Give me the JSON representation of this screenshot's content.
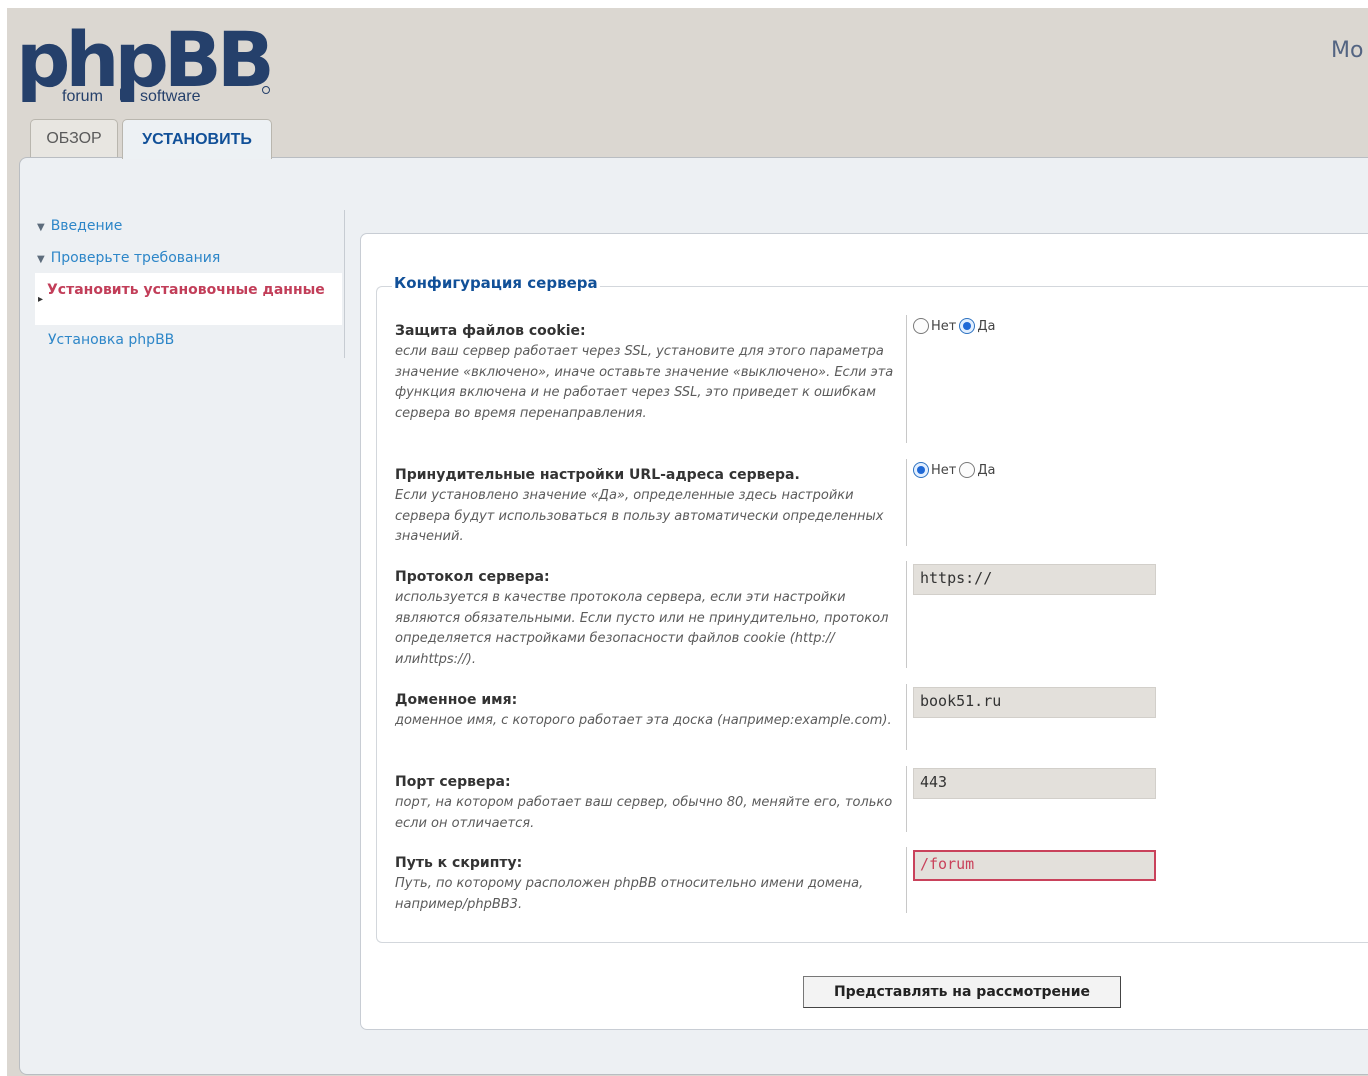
{
  "logo": {
    "name": "phpBB",
    "tagline_left": "forum",
    "tagline_right": "software"
  },
  "header": {
    "right_text": "Mo"
  },
  "tabs": [
    {
      "label": "ОБЗОР"
    },
    {
      "label": "УСТАНОВИТЬ"
    }
  ],
  "sidebar": {
    "items": [
      {
        "label": "Введение"
      },
      {
        "label": "Проверьте требования"
      },
      {
        "label": "Установить установочные данные"
      },
      {
        "label": "Установка phpBB"
      }
    ]
  },
  "form": {
    "legend": "Конфигурация сервера",
    "options": [
      {
        "label": "Защита файлов cookie:",
        "description": "если ваш сервер работает через SSL, установите для этого параметра значение «включено», иначе оставьте значение «выключено». Если эта функция включена и не работает через SSL, это приведет к ошибкам сервера во время перенаправления.",
        "choices": [
          "Нет",
          "Да"
        ],
        "selected": "Да"
      },
      {
        "label": "Принудительные настройки URL-адреса сервера.",
        "description": "Если установлено значение «Да», определенные здесь настройки сервера будут использоваться в пользу автоматически определенных значений.",
        "choices": [
          "Нет",
          "Да"
        ],
        "selected": "Нет"
      },
      {
        "label": "Протокол сервера:",
        "description": "используется в качестве протокола сервера, если эти настройки являются обязательными. Если пусто или не принудительно, протокол определяется настройками безопасности файлов cookie (http://илиhttps://).",
        "value": "https://"
      },
      {
        "label": "Доменное имя:",
        "description": "доменное имя, с которого работает эта доска (например:example.com).",
        "value": "book51.ru"
      },
      {
        "label": "Порт сервера:",
        "description": "порт, на котором работает ваш сервер, обычно 80, меняйте его, только если он отличается.",
        "value": "443"
      },
      {
        "label": "Путь к скрипту:",
        "description": "Путь, по которому расположен phpBB относительно имени домена, например/phpBB3.",
        "value": "/forum"
      }
    ],
    "submit_label": "Представлять на рассмотрение"
  },
  "colors": {
    "accent": "#115098",
    "link": "#2d86c8",
    "active_menu": "#c23e59",
    "error_border": "#c9425b"
  }
}
